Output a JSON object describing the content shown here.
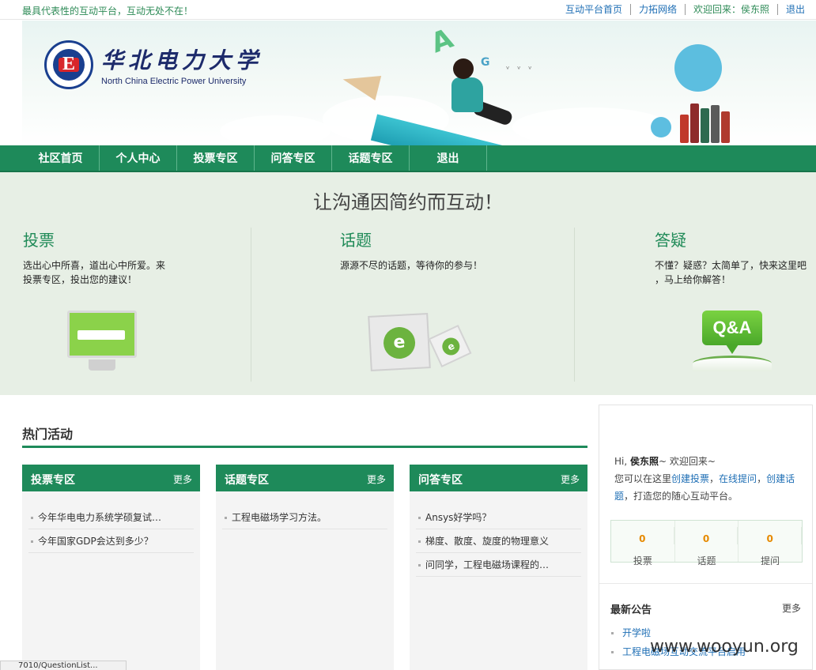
{
  "topbar": {
    "slogan": "最具代表性的互动平台，互动无处不在！",
    "links": [
      "互动平台首页",
      "力拓网络",
      "欢迎回来：侯东照",
      "退出"
    ]
  },
  "banner": {
    "school_cn": "华北电力大学",
    "school_en": "North China Electric Power University"
  },
  "nav": {
    "items": [
      "社区首页",
      "个人中心",
      "投票专区",
      "问答专区",
      "话题专区",
      "退出"
    ]
  },
  "intro": {
    "headline": "让沟通因简约而互动！",
    "vote": {
      "title": "投票",
      "desc_1": "选出心中所喜，道出心中所爱。来",
      "desc_2": "投票专区，投出您的建议！"
    },
    "topic": {
      "title": "话题",
      "desc_1": "源源不尽的话题，等待你的参与！"
    },
    "qa": {
      "title": "答疑",
      "desc_1": "不懂？疑惑？太简单了，快来这里吧",
      "desc_2": "，马上给你解答！",
      "badge": "Q&A"
    }
  },
  "hot": {
    "title": "热门活动",
    "panels": [
      {
        "title": "投票专区",
        "more": "更多",
        "items": [
          "今年华电电力系统学硕复试…",
          "今年国家GDP会达到多少？"
        ]
      },
      {
        "title": "话题专区",
        "more": "更多",
        "items": [
          "工程电磁场学习方法。"
        ]
      },
      {
        "title": "问答专区",
        "more": "更多",
        "items": [
          "Ansys好学吗？",
          "梯度、散度、旋度的物理意义",
          "问同学，工程电磁场课程的…"
        ]
      }
    ]
  },
  "sidebar": {
    "hi": "Hi,",
    "user": "侯东照",
    "welcome": "~ 欢迎回来~",
    "line2_prefix": "您可以在这里",
    "link_vote": "创建投票",
    "comma1": "，",
    "link_ask": "在线提问",
    "comma2": "，",
    "link_topic": "创建话题",
    "line2_suffix": "，打造您的随心互动平台。",
    "stats": [
      {
        "num": "0",
        "label": "投票"
      },
      {
        "num": "0",
        "label": "话题"
      },
      {
        "num": "0",
        "label": "提问"
      }
    ],
    "notice_title": "最新公告",
    "notice_more": "更多",
    "notices": [
      "开学啦",
      "工程电磁场互动交流平台启用"
    ]
  },
  "watermark": "www.wooyun.org",
  "status": "7010/QuestionList..."
}
